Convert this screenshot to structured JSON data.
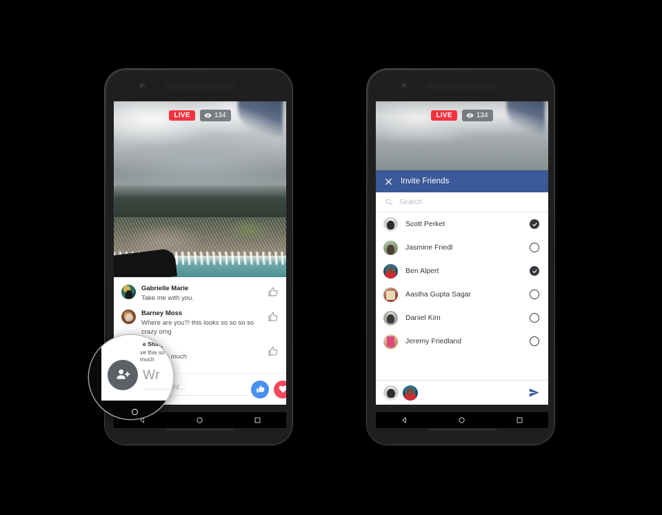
{
  "background_color": "#000000",
  "accent_colors": {
    "facebook_blue": "#3b5998",
    "live_red": "#f5313f",
    "like_blue": "#4a90f0",
    "love_red": "#f5485e",
    "send_blue": "#3b5998"
  },
  "left_phone": {
    "name": "facebook-live-broadcast-screen",
    "video": {
      "live_badge": "LIVE",
      "viewer_count": "134",
      "viewer_icon": "eye-icon",
      "scene": "aerial-coastline-from-airplane"
    },
    "comments": [
      {
        "author": "Gabrielle Marie",
        "text": "Take me with you.",
        "avatar": "av-gab",
        "like_icon": "thumbs-up-outline-icon"
      },
      {
        "author": "Barney Moss",
        "text": "Where are you?! this looks so so so so crazy omg",
        "avatar": "av-barney",
        "like_icon": "thumbs-up-outline-icon"
      },
      {
        "author": "e Shah",
        "text": "ve this so much",
        "avatar": "av-partial",
        "like_icon": "thumbs-up-outline-icon"
      }
    ],
    "composer": {
      "placeholder": "Write a comment...",
      "visible_text": "Wr",
      "occluded_text": "mment...",
      "like_button": "thumbs-up-filled-icon",
      "love_button": "heart-filled-icon"
    },
    "navbar": {
      "back": "triangle-back-icon",
      "home": "circle-home-icon",
      "recents": "square-recents-icon"
    }
  },
  "magnifier": {
    "name": "zoom-lens-callout",
    "highlights_button": "add-friend-button",
    "icon": "person-add-icon",
    "visible_text": "Wr",
    "comment_name_fragment": "e Shah",
    "comment_text_fragment": "ve this so much"
  },
  "right_phone": {
    "name": "invite-friends-dialog-screen",
    "video": {
      "live_badge": "LIVE",
      "viewer_count": "134",
      "viewer_icon": "eye-icon"
    },
    "dialog": {
      "close_icon": "close-x-icon",
      "title": "Invite Friends",
      "search": {
        "icon": "search-icon",
        "placeholder": "Search",
        "value": ""
      },
      "friends": [
        {
          "name": "Scott Perket",
          "avatar": "a-scott",
          "selected": true
        },
        {
          "name": "Jasmine Friedl",
          "avatar": "a-jasmine",
          "selected": false
        },
        {
          "name": "Ben Alpert",
          "avatar": "a-ben",
          "selected": true
        },
        {
          "name": "Aastha Gupta Sagar",
          "avatar": "a-aastha",
          "selected": false
        },
        {
          "name": "Daniel Kim",
          "avatar": "a-daniel",
          "selected": false
        },
        {
          "name": "Jeremy Friedland",
          "avatar": "a-jeremy",
          "selected": false
        }
      ],
      "send_bar": {
        "selected_avatars": [
          "a-scott",
          "a-ben"
        ],
        "send_icon": "send-paper-plane-icon"
      }
    },
    "navbar": {
      "back": "triangle-back-icon",
      "home": "circle-home-icon",
      "recents": "square-recents-icon"
    }
  }
}
